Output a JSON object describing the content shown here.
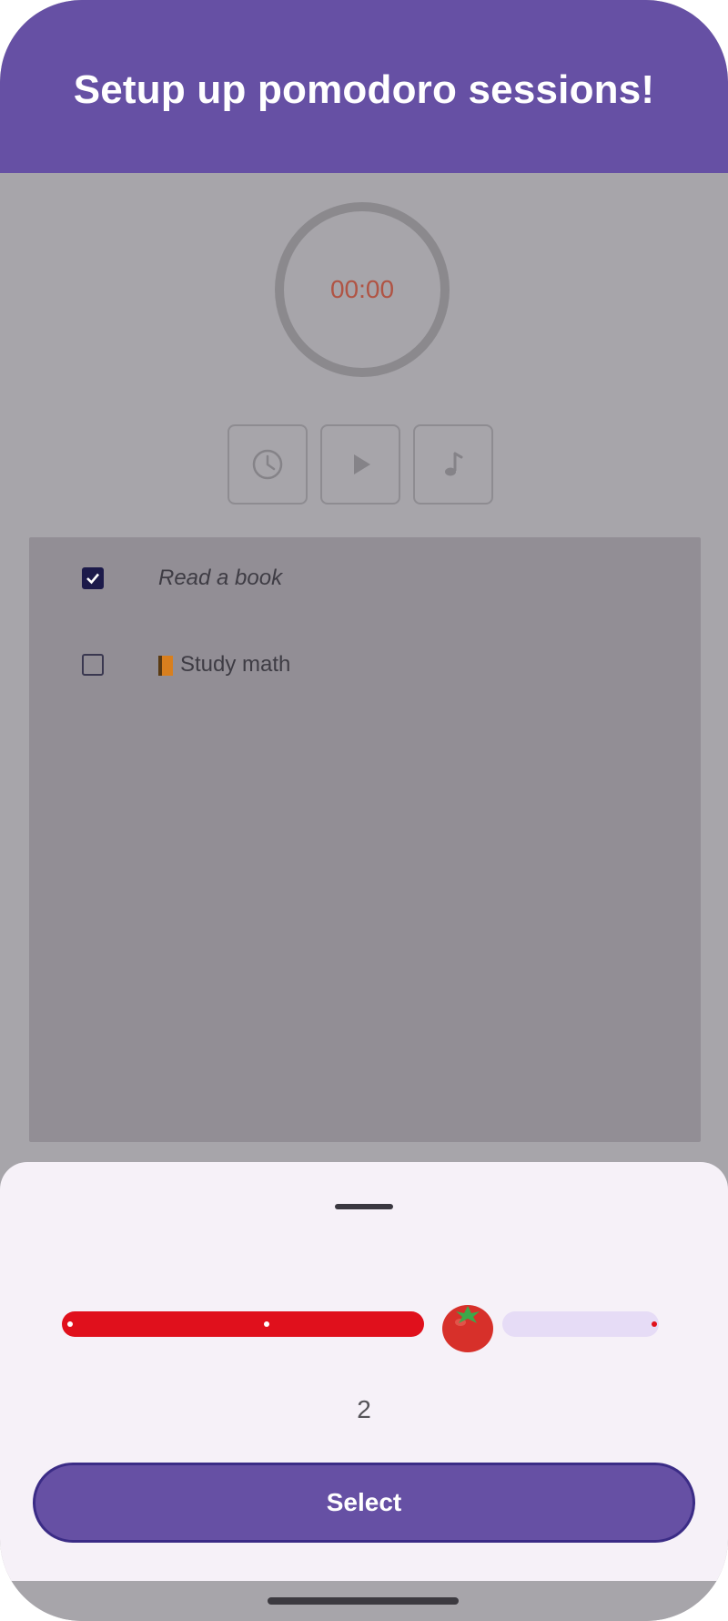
{
  "header": {
    "title": "Setup up pomodoro sessions!"
  },
  "timer": {
    "display": "00:00"
  },
  "controls": [
    {
      "icon": "clock-icon"
    },
    {
      "icon": "play-icon"
    },
    {
      "icon": "music-note-icon"
    }
  ],
  "tasks": [
    {
      "label": "Read a book",
      "checked": true
    },
    {
      "label": "Study math",
      "checked": false,
      "icon": "book-icon"
    }
  ],
  "sheet": {
    "slider": {
      "value": 2,
      "min": 0,
      "max": 4,
      "thumb_icon": "tomato-icon"
    },
    "session_count": "2",
    "select_label": "Select"
  },
  "colors": {
    "primary": "#6650a4",
    "slider_active": "#e0101c",
    "slider_inactive": "#e6dcf6",
    "timer_text": "#b05444"
  }
}
